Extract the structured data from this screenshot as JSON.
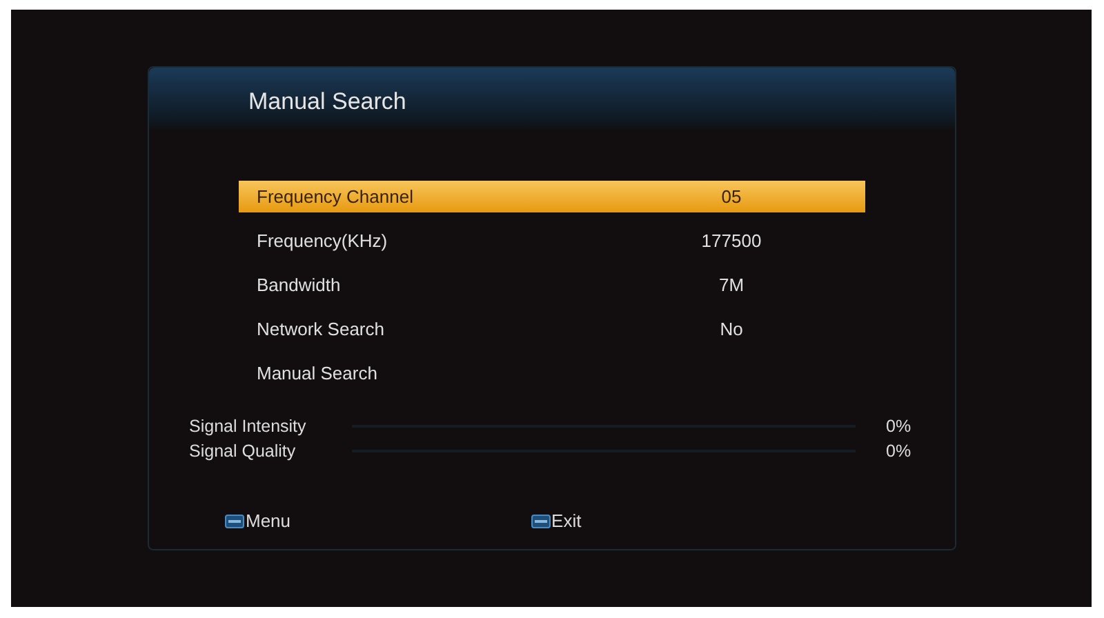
{
  "window": {
    "title": "Manual Search"
  },
  "menu_items": [
    {
      "label": "Frequency Channel",
      "value": "05",
      "selected": true
    },
    {
      "label": "Frequency(KHz)",
      "value": "177500",
      "selected": false
    },
    {
      "label": "Bandwidth",
      "value": "7M",
      "selected": false
    },
    {
      "label": "Network Search",
      "value": "No",
      "selected": false
    },
    {
      "label": "Manual Search",
      "selected": false
    }
  ],
  "signals": [
    {
      "label": "Signal Intensity",
      "level": 0,
      "reading": "0%"
    },
    {
      "label": "Signal Quality",
      "level": 0,
      "reading": "0%"
    }
  ],
  "footer": [
    {
      "label": "Menu"
    },
    {
      "label": "Exit"
    }
  ]
}
